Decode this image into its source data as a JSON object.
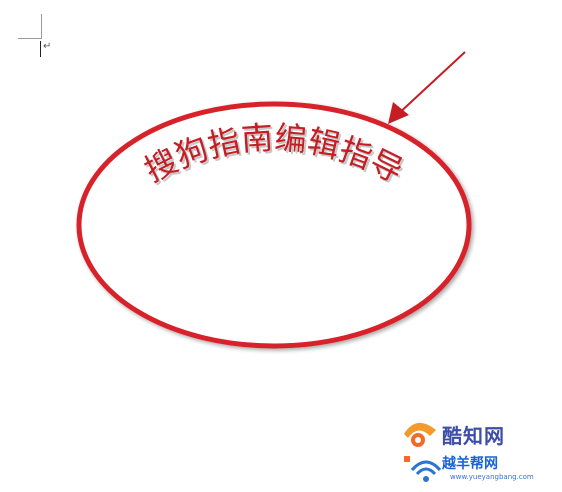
{
  "document": {
    "paragraph_mark": "↵"
  },
  "wordart": {
    "text": "搜狗指南编辑指导",
    "color": "#c51d24",
    "shadow_color": "#9a9a9a"
  },
  "shape": {
    "type": "ellipse",
    "outline_color": "#d8202a",
    "fill_color": "#ffffff"
  },
  "annotation_arrow": {
    "color": "#c51d24",
    "icon": "arrow-icon"
  },
  "watermark": {
    "name_1": "酷知网",
    "name_2": "越羊帮网",
    "url": "www.yueyangbang.com",
    "icons": [
      "kuzhi-logo-icon",
      "wifi-logo-icon"
    ]
  }
}
